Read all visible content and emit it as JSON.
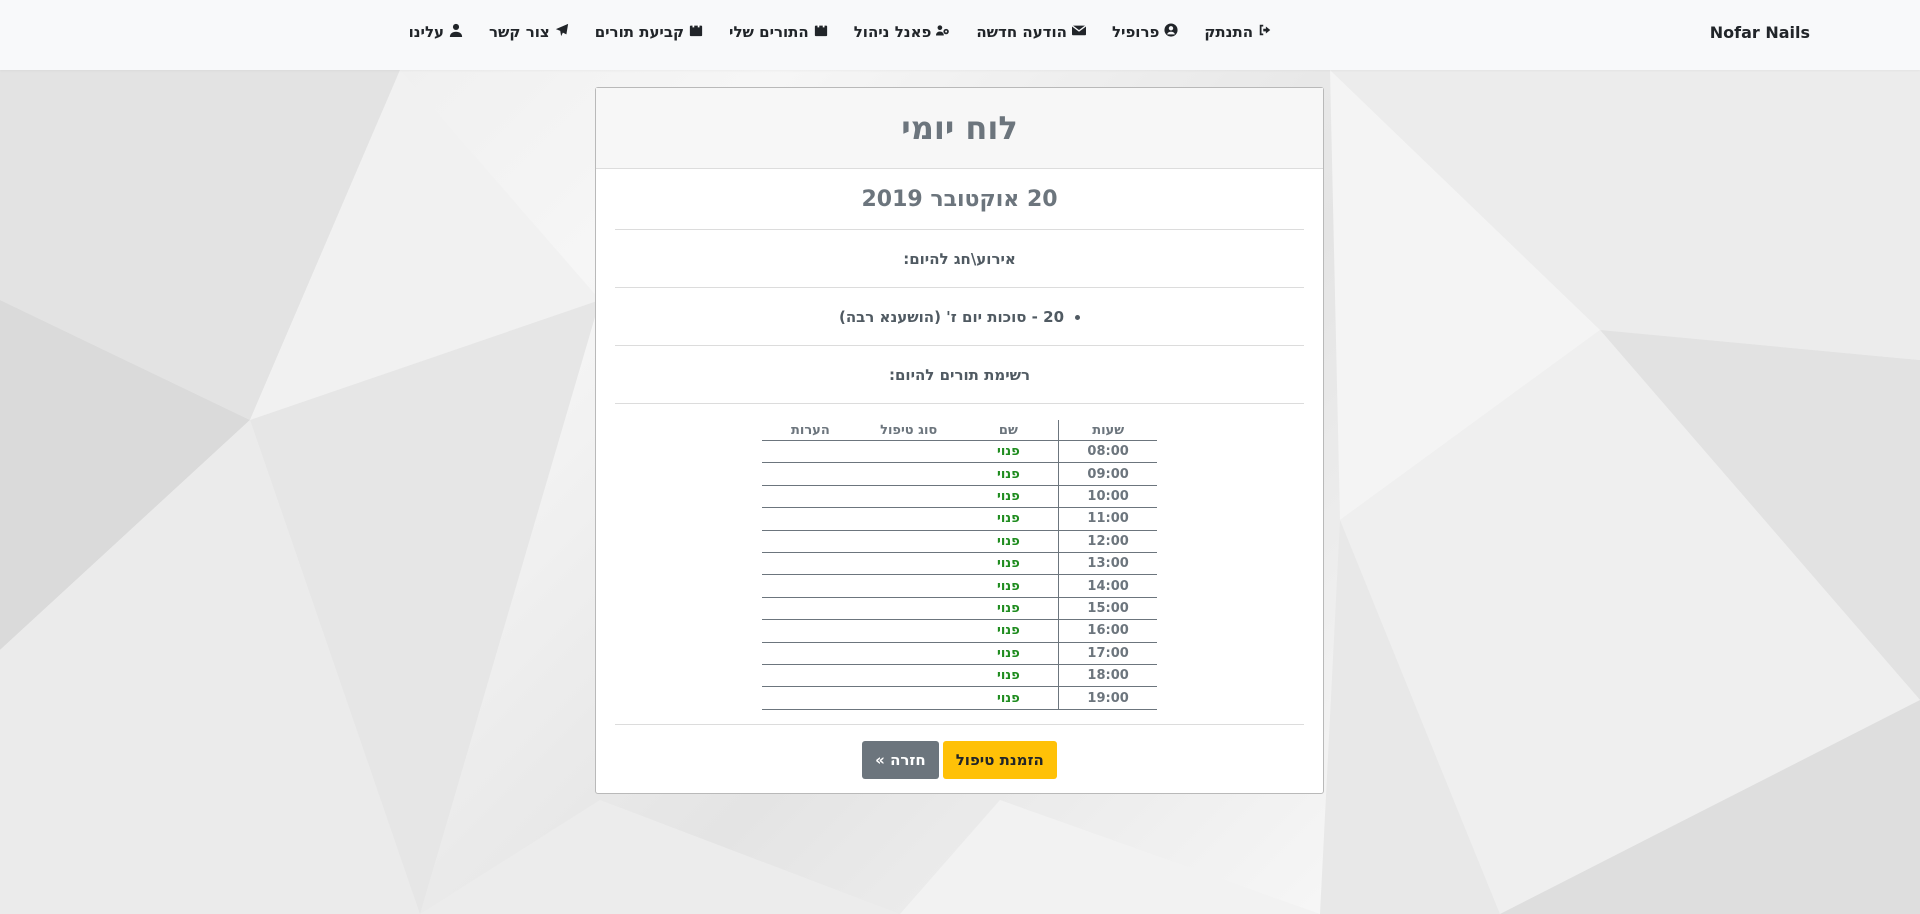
{
  "brand": "Nofar Nails",
  "nav": [
    {
      "label": "עלינו",
      "icon": "user-icon"
    },
    {
      "label": "צור קשר",
      "icon": "paper-plane-icon"
    },
    {
      "label": "קביעת תורים",
      "icon": "calendar-icon"
    },
    {
      "label": "התורים שלי",
      "icon": "calendar-icon"
    },
    {
      "label": "פאנל ניהול",
      "icon": "users-cog-icon"
    },
    {
      "label": "הודעה חדשה",
      "icon": "envelope-icon"
    },
    {
      "label": "פרופיל",
      "icon": "user-circle-icon"
    },
    {
      "label": "התנתק",
      "icon": "sign-out-icon"
    }
  ],
  "card": {
    "title": "לוח יומי",
    "date": "20 אוקטובר 2019",
    "events_heading": "אירוע\\חג להיום:",
    "events": [
      "20 - סוכות יום ז' (הושענא רבה)"
    ],
    "appointments_heading": "רשימת תורים להיום:"
  },
  "table": {
    "headers": {
      "time": "שעות",
      "name": "שם",
      "type": "סוג טיפול",
      "notes": "הערות"
    },
    "rows": [
      {
        "time": "08:00",
        "name": "פנוי",
        "type": "",
        "notes": ""
      },
      {
        "time": "09:00",
        "name": "פנוי",
        "type": "",
        "notes": ""
      },
      {
        "time": "10:00",
        "name": "פנוי",
        "type": "",
        "notes": ""
      },
      {
        "time": "11:00",
        "name": "פנוי",
        "type": "",
        "notes": ""
      },
      {
        "time": "12:00",
        "name": "פנוי",
        "type": "",
        "notes": ""
      },
      {
        "time": "13:00",
        "name": "פנוי",
        "type": "",
        "notes": ""
      },
      {
        "time": "14:00",
        "name": "פנוי",
        "type": "",
        "notes": ""
      },
      {
        "time": "15:00",
        "name": "פנוי",
        "type": "",
        "notes": ""
      },
      {
        "time": "16:00",
        "name": "פנוי",
        "type": "",
        "notes": ""
      },
      {
        "time": "17:00",
        "name": "פנוי",
        "type": "",
        "notes": ""
      },
      {
        "time": "18:00",
        "name": "פנוי",
        "type": "",
        "notes": ""
      },
      {
        "time": "19:00",
        "name": "פנוי",
        "type": "",
        "notes": ""
      }
    ]
  },
  "buttons": {
    "book": "הזמנת טיפול",
    "back": "חזרה »"
  },
  "colors": {
    "available": "#1f8c1f",
    "warning": "#ffc107",
    "secondary": "#6c757d"
  }
}
